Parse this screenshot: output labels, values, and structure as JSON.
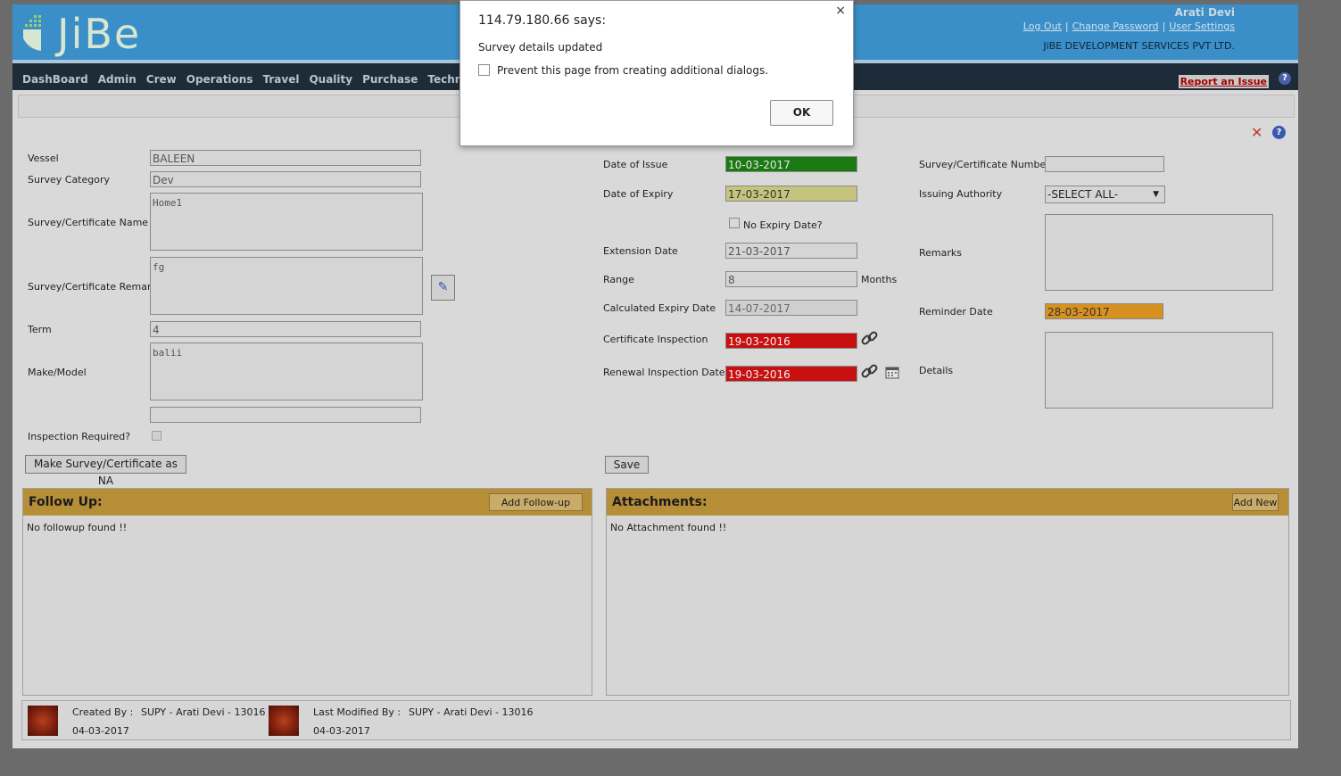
{
  "app": {
    "logo_text": "JiBe",
    "user_name": "Arati Devi",
    "links": [
      "Log Out",
      "Change Password",
      "User Settings"
    ],
    "company": "JiBE DEVELOPMENT SERVICES PVT LTD."
  },
  "nav": {
    "items": [
      "DashBoard",
      "Admin",
      "Crew",
      "Operations",
      "Travel",
      "Quality",
      "Purchase",
      "Technic"
    ],
    "report_issue": "Report an Issue",
    "help": "?"
  },
  "form": {
    "left": {
      "vessel_label": "Vessel",
      "vessel_value": "BALEEN",
      "category_label": "Survey Category",
      "category_value": "Dev",
      "name_label": "Survey/Certificate Name",
      "name_value": "Home1",
      "remarks_label": "Survey/Certificate Remarks",
      "remarks_value": "fg",
      "term_label": "Term",
      "term_value": "4",
      "make_label": "Make/Model",
      "make_value": "balii",
      "inspection_label": "Inspection Required?",
      "na_button": "Make Survey/Certificate as NA"
    },
    "middle": {
      "issue_label": "Date of Issue",
      "issue_value": "10-03-2017",
      "expiry_label": "Date of Expiry",
      "expiry_value": "17-03-2017",
      "no_expiry_label": "No Expiry Date?",
      "extension_label": "Extension Date",
      "extension_value": "21-03-2017",
      "range_label": "Range",
      "range_value": "8",
      "range_unit": "Months",
      "calc_expiry_label": "Calculated Expiry Date",
      "calc_expiry_value": "14-07-2017",
      "cert_inspection_label": "Certificate Inspection",
      "cert_inspection_value": "19-03-2016",
      "renewal_label": "Renewal Inspection Date",
      "renewal_value": "19-03-2016",
      "save_button": "Save"
    },
    "right": {
      "number_label": "Survey/Certificate Number",
      "number_value": "",
      "authority_label": "Issuing Authority",
      "authority_value": "-SELECT ALL-",
      "remarks_label": "Remarks",
      "reminder_label": "Reminder Date",
      "reminder_value": "28-03-2017",
      "details_label": "Details"
    }
  },
  "followup": {
    "title": "Follow Up:",
    "button": "Add Follow-up",
    "empty": "No followup found !!"
  },
  "attachments": {
    "title": "Attachments:",
    "button": "Add New",
    "empty": "No Attachment found !!"
  },
  "footer": {
    "created_label": "Created By :",
    "created_by": "SUPY - Arati Devi - 13016",
    "created_date": "04-03-2017",
    "modified_label": "Last Modified By :",
    "modified_by": "SUPY - Arati Devi - 13016",
    "modified_date": "04-03-2017"
  },
  "dialog": {
    "title": "114.79.180.66 says:",
    "message": "Survey details updated",
    "checkbox_label": "Prevent this page from creating additional dialogs.",
    "ok": "OK",
    "close": "×"
  },
  "colors": {
    "header": "#3a8fc8",
    "navbar": "#1e2b38",
    "issue_green": "#1a7a12",
    "expiry_yellow": "#c4c47e",
    "inspection_red": "#c81010",
    "reminder_orange": "#d69120",
    "panel_head": "#b58e37"
  }
}
